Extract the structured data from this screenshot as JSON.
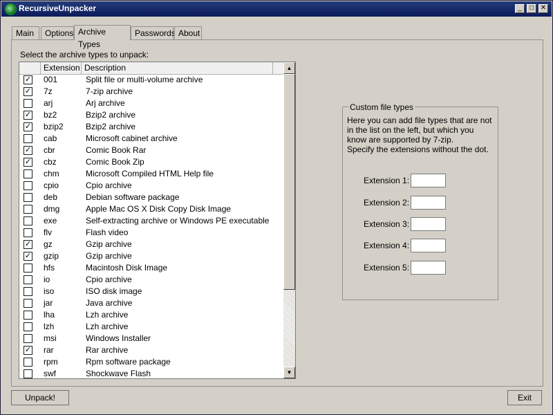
{
  "window": {
    "title": "RecursiveUnpacker"
  },
  "title_buttons": {
    "minimize": "_",
    "maximize": "□",
    "close": "✕"
  },
  "tabs": [
    {
      "label": "Main"
    },
    {
      "label": "Options"
    },
    {
      "label": "Archive Types"
    },
    {
      "label": "Passwords"
    },
    {
      "label": "About"
    }
  ],
  "archive_types": {
    "prompt": "Select the archive types to unpack:",
    "columns": {
      "extension": "Extension",
      "description": "Description"
    },
    "rows": [
      {
        "ext": "001",
        "desc": "Split file or multi-volume archive",
        "mark": "✓"
      },
      {
        "ext": "7z",
        "desc": "7-zip archive",
        "mark": "✓"
      },
      {
        "ext": "arj",
        "desc": "Arj archive",
        "mark": ""
      },
      {
        "ext": "bz2",
        "desc": "Bzip2 archive",
        "mark": "✓"
      },
      {
        "ext": "bzip2",
        "desc": "Bzip2 archive",
        "mark": "✓"
      },
      {
        "ext": "cab",
        "desc": "Microsoft cabinet archive",
        "mark": ""
      },
      {
        "ext": "cbr",
        "desc": "Comic Book Rar",
        "mark": "✓"
      },
      {
        "ext": "cbz",
        "desc": "Comic Book Zip",
        "mark": "✓"
      },
      {
        "ext": "chm",
        "desc": "Microsoft Compiled HTML Help file",
        "mark": ""
      },
      {
        "ext": "cpio",
        "desc": "Cpio archive",
        "mark": ""
      },
      {
        "ext": "deb",
        "desc": "Debian software package",
        "mark": ""
      },
      {
        "ext": "dmg",
        "desc": "Apple Mac OS X Disk Copy Disk Image",
        "mark": ""
      },
      {
        "ext": "exe",
        "desc": "Self-extracting archive or Windows PE executable",
        "mark": ""
      },
      {
        "ext": "flv",
        "desc": "Flash video",
        "mark": ""
      },
      {
        "ext": "gz",
        "desc": "Gzip archive",
        "mark": "✓"
      },
      {
        "ext": "gzip",
        "desc": "Gzip archive",
        "mark": "✓"
      },
      {
        "ext": "hfs",
        "desc": "Macintosh Disk Image",
        "mark": ""
      },
      {
        "ext": "io",
        "desc": "Cpio archive",
        "mark": ""
      },
      {
        "ext": "iso",
        "desc": "ISO disk image",
        "mark": ""
      },
      {
        "ext": "jar",
        "desc": "Java archive",
        "mark": ""
      },
      {
        "ext": "lha",
        "desc": "Lzh archive",
        "mark": ""
      },
      {
        "ext": "lzh",
        "desc": "Lzh archive",
        "mark": ""
      },
      {
        "ext": "msi",
        "desc": "Windows Installer",
        "mark": ""
      },
      {
        "ext": "rar",
        "desc": "Rar archive",
        "mark": "✓"
      },
      {
        "ext": "rpm",
        "desc": "Rpm software package",
        "mark": ""
      },
      {
        "ext": "swf",
        "desc": "Shockwave Flash",
        "mark": ""
      }
    ]
  },
  "scrollbar": {
    "up": "▲",
    "down": "▼"
  },
  "custom": {
    "title": "Custom file types",
    "description": "Here you can add file types that are not in the list on the left, but which you know are supported by 7-zip.\nSpecify the extensions without the dot.",
    "labels": [
      "Extension 1:",
      "Extension 2:",
      "Extension 3:",
      "Extension 4:",
      "Extension 5:"
    ],
    "values": [
      "",
      "",
      "",
      "",
      ""
    ]
  },
  "buttons": {
    "unpack": "Unpack!",
    "exit": "Exit"
  }
}
